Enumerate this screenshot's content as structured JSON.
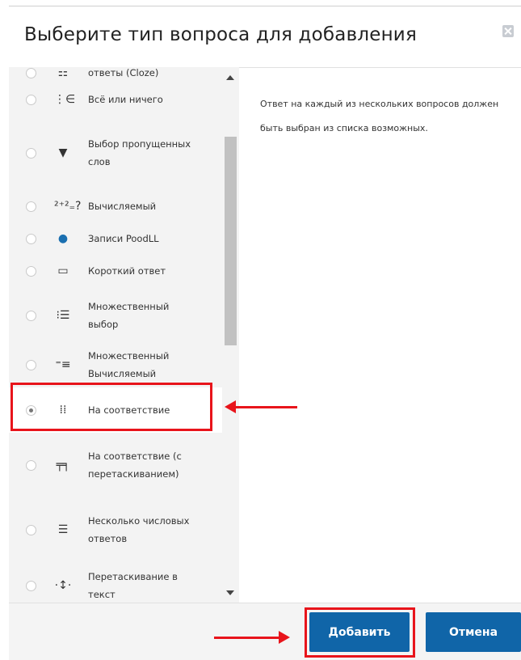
{
  "dialog": {
    "title": "Выберите тип вопроса для добавления"
  },
  "question_types": [
    {
      "label": "ответы (Cloze)",
      "icon": "cloze-icon",
      "glyph": "⚏",
      "selected": false
    },
    {
      "label": "Всё или ничего",
      "icon": "all-or-nothing-icon",
      "glyph": "⋮∈",
      "selected": false
    },
    {
      "label": "Выбор пропущенных слов",
      "icon": "dropdown-triangle-icon",
      "glyph": "▼",
      "selected": false
    },
    {
      "label": "Вычисляемый",
      "icon": "calculated-icon",
      "glyph": "²⁺²₌?",
      "selected": false
    },
    {
      "label": "Записи PoodLL",
      "icon": "poodll-icon",
      "glyph": "●",
      "selected": false
    },
    {
      "label": "Короткий ответ",
      "icon": "short-answer-icon",
      "glyph": "▭",
      "selected": false
    },
    {
      "label": "Множественный выбор",
      "icon": "multiple-choice-icon",
      "glyph": "⁝☰",
      "selected": false
    },
    {
      "label": "Множественный Вычисляемый",
      "icon": "calculated-multi-icon",
      "glyph": "⁼≡",
      "selected": false
    },
    {
      "label": "На соответствие",
      "icon": "matching-icon",
      "glyph": "⁞⁞",
      "selected": true
    },
    {
      "label": "На соответствие (с перетаскиванием)",
      "icon": "drag-drop-matching-icon",
      "glyph": "╤╕",
      "selected": false
    },
    {
      "label": "Несколько числовых ответов",
      "icon": "numerical-multi-icon",
      "glyph": "☰",
      "selected": false
    },
    {
      "label": "Перетаскивание в текст",
      "icon": "drag-into-text-icon",
      "glyph": "·↕·",
      "selected": false
    }
  ],
  "description": "Ответ на каждый из нескольких вопросов должен быть выбран из списка возможных.",
  "buttons": {
    "add": "Добавить",
    "cancel": "Отмена"
  },
  "colors": {
    "primary_button": "#1065a8",
    "highlight": "#e8141b",
    "list_background": "#f3f3f3"
  }
}
